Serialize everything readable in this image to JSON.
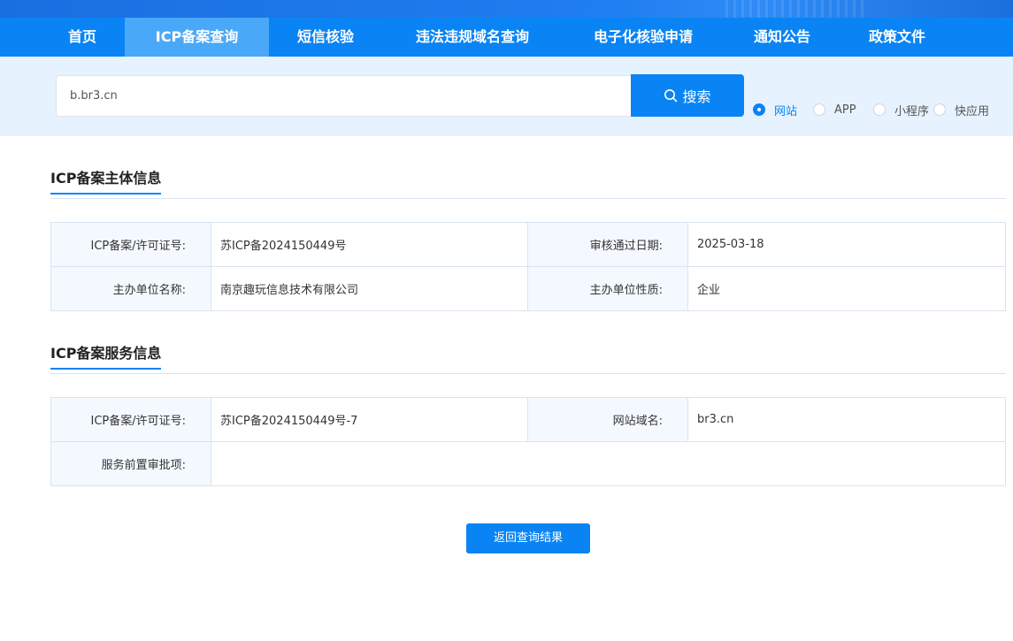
{
  "nav": {
    "items": [
      {
        "label": "首页"
      },
      {
        "label": "ICP备案查询"
      },
      {
        "label": "短信核验"
      },
      {
        "label": "违法违规域名查询"
      },
      {
        "label": "电子化核验申请"
      },
      {
        "label": "通知公告"
      },
      {
        "label": "政策文件"
      }
    ],
    "active": "ICP备案查询"
  },
  "search": {
    "value": "b.br3.cn",
    "button_label": "搜索",
    "types": [
      {
        "label": "网站",
        "checked": true
      },
      {
        "label": "APP",
        "checked": false
      },
      {
        "label": "小程序",
        "checked": false
      },
      {
        "label": "快应用",
        "checked": false
      }
    ]
  },
  "subject": {
    "title": "ICP备案主体信息",
    "license_label": "ICP备案/许可证号:",
    "license_value": "苏ICP备2024150449号",
    "date_label": "审核通过日期:",
    "date_value": "2025-03-18",
    "org_label": "主办单位名称:",
    "org_value": "南京趣玩信息技术有限公司",
    "nature_label": "主办单位性质:",
    "nature_value": "企业"
  },
  "service": {
    "title": "ICP备案服务信息",
    "license_label": "ICP备案/许可证号:",
    "license_value": "苏ICP备2024150449号-7",
    "domain_label": "网站域名:",
    "domain_value": "br3.cn",
    "approval_label": "服务前置审批项:",
    "approval_value": ""
  },
  "back_button_label": "返回查询结果",
  "colors": {
    "primary": "#0a84f4",
    "nav_active": "#4aa8f8",
    "search_band": "#e6f2fd"
  }
}
